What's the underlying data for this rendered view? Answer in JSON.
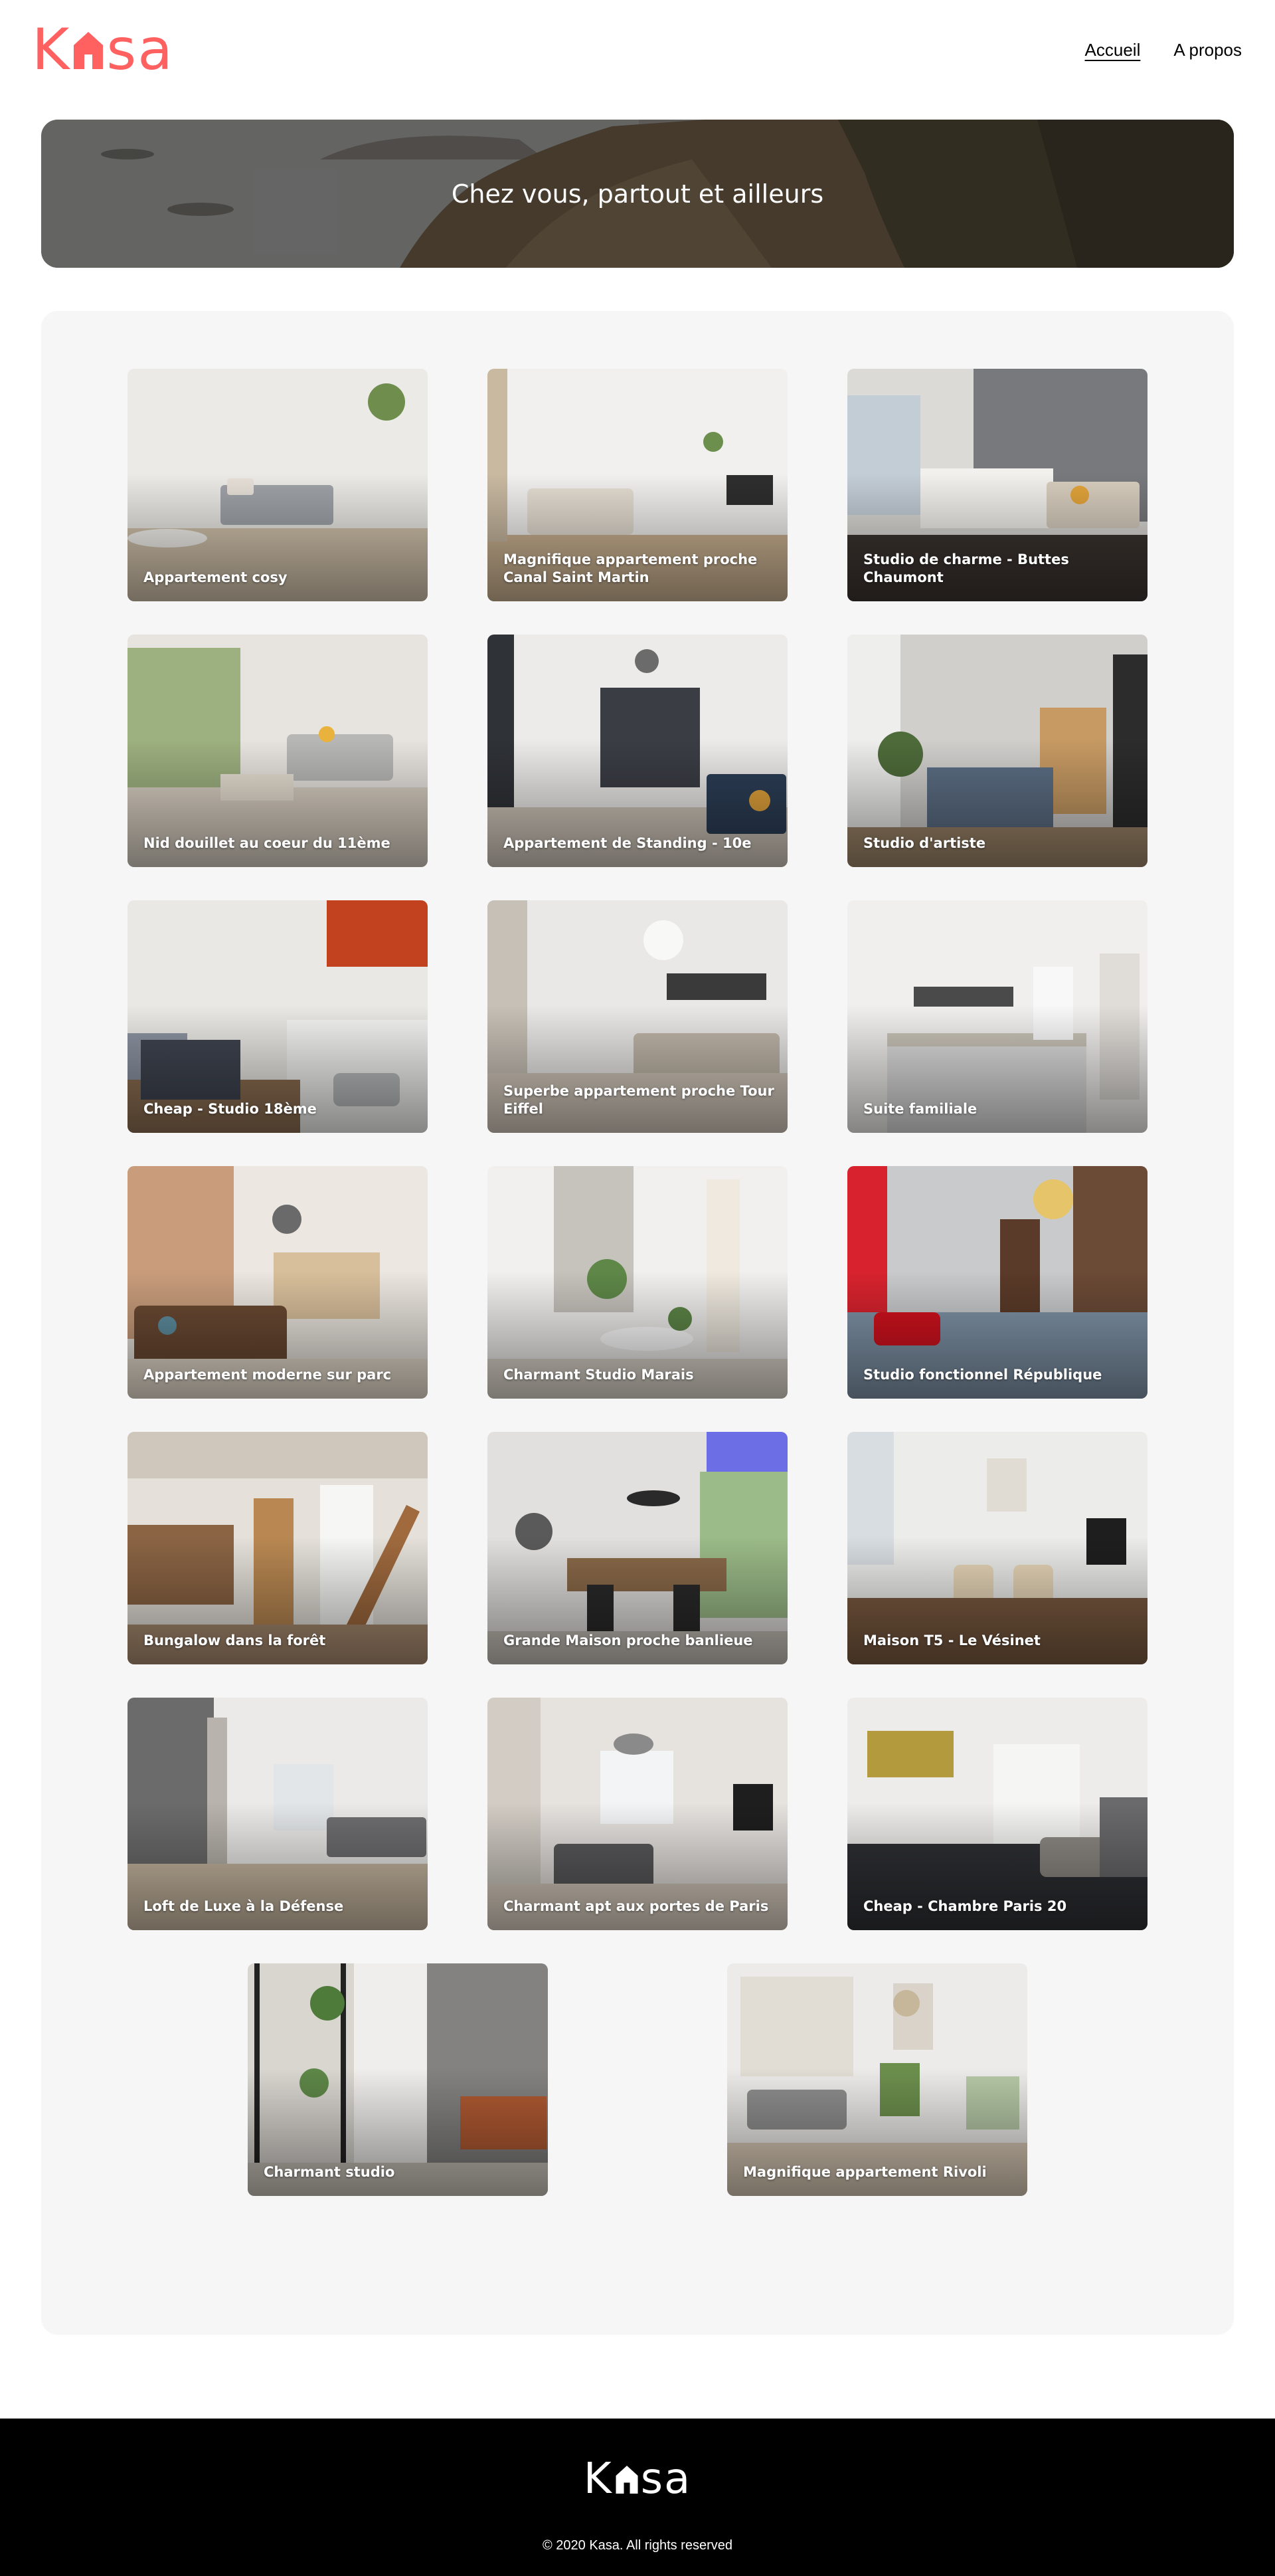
{
  "brand": {
    "logo_k": "K",
    "logo_rest": "sa",
    "color": "#FF6060"
  },
  "nav": {
    "home": "Accueil",
    "about": "A propos"
  },
  "banner": {
    "title": "Chez vous, partout et ailleurs"
  },
  "listings": [
    {
      "title": "Appartement cosy"
    },
    {
      "title": "Magnifique appartement proche Canal Saint Martin"
    },
    {
      "title": "Studio de charme - Buttes Chaumont"
    },
    {
      "title": "Nid douillet au coeur du 11ème"
    },
    {
      "title": "Appartement de Standing - 10e"
    },
    {
      "title": "Studio d'artiste"
    },
    {
      "title": "Cheap - Studio 18ème"
    },
    {
      "title": "Superbe appartement proche Tour Eiffel"
    },
    {
      "title": "Suite familiale"
    },
    {
      "title": "Appartement moderne sur parc"
    },
    {
      "title": "Charmant Studio Marais"
    },
    {
      "title": "Studio fonctionnel République"
    },
    {
      "title": "Bungalow dans la forêt"
    },
    {
      "title": "Grande Maison proche banlieue"
    },
    {
      "title": "Maison T5 - Le Vésinet"
    },
    {
      "title": "Loft de Luxe à la Défense"
    },
    {
      "title": "Charmant apt aux portes de Paris"
    },
    {
      "title": "Cheap - Chambre Paris 20"
    },
    {
      "title": "Charmant studio"
    },
    {
      "title": "Magnifique appartement Rivoli"
    }
  ],
  "footer": {
    "copyright": "© 2020 Kasa. All rights reserved"
  }
}
